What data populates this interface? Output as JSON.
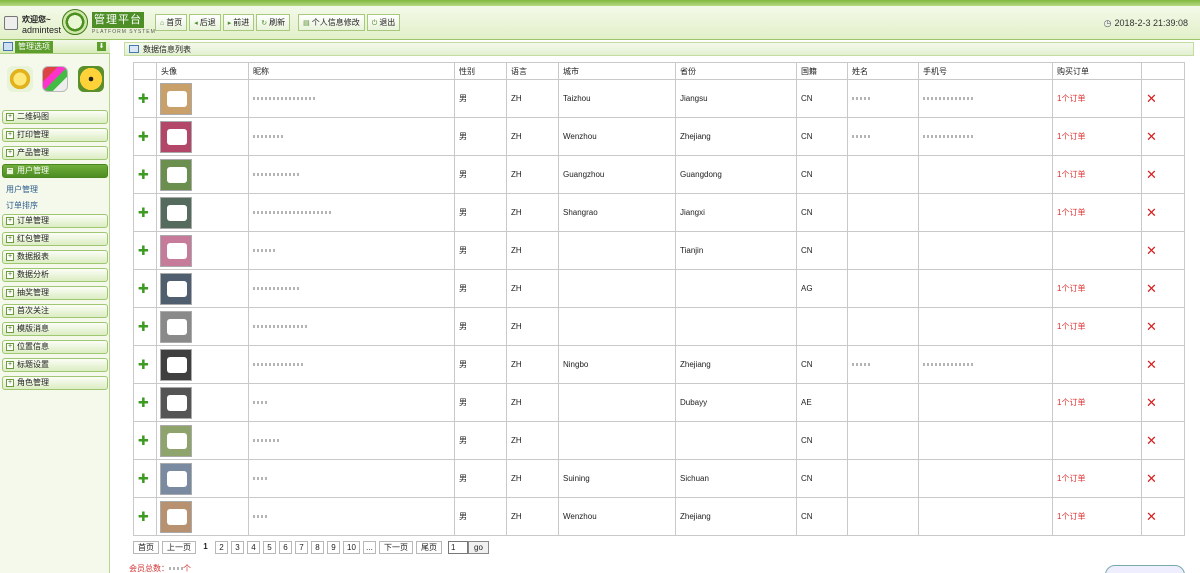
{
  "header": {
    "welcome": "欢迎您~",
    "username": "admintest",
    "logo_title": "管理平台",
    "logo_subtitle": "PLATFORM SYSTEM",
    "nav": [
      {
        "label": "首页",
        "icon": "home-icon"
      },
      {
        "label": "后退",
        "icon": "back-icon"
      },
      {
        "label": "前进",
        "icon": "forward-icon"
      },
      {
        "label": "刷新",
        "icon": "refresh-icon"
      },
      {
        "label": "个人信息修改",
        "icon": "profile-icon"
      },
      {
        "label": "退出",
        "icon": "logout-icon"
      }
    ],
    "datetime": "2018-2-3 21:39:08"
  },
  "sidebar": {
    "title": "管理选项",
    "menu": [
      {
        "label": "二维码图",
        "state": "closed"
      },
      {
        "label": "打印管理",
        "state": "closed"
      },
      {
        "label": "产品管理",
        "state": "closed"
      },
      {
        "label": "用户管理",
        "state": "open",
        "children": [
          "用户管理",
          "订单排序"
        ]
      },
      {
        "label": "订单管理",
        "state": "closed"
      },
      {
        "label": "红包管理",
        "state": "closed"
      },
      {
        "label": "数据报表",
        "state": "closed"
      },
      {
        "label": "数据分析",
        "state": "closed"
      },
      {
        "label": "抽奖管理",
        "state": "closed"
      },
      {
        "label": "首次关注",
        "state": "closed"
      },
      {
        "label": "模版消息",
        "state": "closed"
      },
      {
        "label": "位置信息",
        "state": "closed"
      },
      {
        "label": "标题设置",
        "state": "closed"
      },
      {
        "label": "角色管理",
        "state": "closed"
      }
    ]
  },
  "panel": {
    "title": "数据信息列表"
  },
  "table": {
    "columns": [
      "",
      "头像",
      "昵称",
      "性别",
      "语言",
      "城市",
      "省份",
      "国籍",
      "姓名",
      "手机号",
      "购买订单",
      ""
    ],
    "rows": [
      {
        "sex": "男",
        "lang": "ZH",
        "city": "Taizhou",
        "province": "Jiangsu",
        "country": "CN",
        "has_name": true,
        "has_phone": true,
        "order": "1个订单"
      },
      {
        "sex": "男",
        "lang": "ZH",
        "city": "Wenzhou",
        "province": "Zhejiang",
        "country": "CN",
        "has_name": true,
        "has_phone": true,
        "order": "1个订单"
      },
      {
        "sex": "男",
        "lang": "ZH",
        "city": "Guangzhou",
        "province": "Guangdong",
        "country": "CN",
        "has_name": false,
        "has_phone": false,
        "order": "1个订单"
      },
      {
        "sex": "男",
        "lang": "ZH",
        "city": "Shangrao",
        "province": "Jiangxi",
        "country": "CN",
        "has_name": false,
        "has_phone": false,
        "order": "1个订单"
      },
      {
        "sex": "男",
        "lang": "ZH",
        "city": "",
        "province": "Tianjin",
        "country": "CN",
        "has_name": false,
        "has_phone": false,
        "order": ""
      },
      {
        "sex": "男",
        "lang": "ZH",
        "city": "",
        "province": "",
        "country": "AG",
        "has_name": false,
        "has_phone": false,
        "order": "1个订单"
      },
      {
        "sex": "男",
        "lang": "ZH",
        "city": "",
        "province": "",
        "country": "",
        "has_name": false,
        "has_phone": false,
        "order": "1个订单"
      },
      {
        "sex": "男",
        "lang": "ZH",
        "city": "Ningbo",
        "province": "Zhejiang",
        "country": "CN",
        "has_name": true,
        "has_phone": true,
        "order": ""
      },
      {
        "sex": "男",
        "lang": "ZH",
        "city": "",
        "province": "Dubayy",
        "country": "AE",
        "has_name": false,
        "has_phone": false,
        "order": "1个订单"
      },
      {
        "sex": "男",
        "lang": "ZH",
        "city": "",
        "province": "",
        "country": "CN",
        "has_name": false,
        "has_phone": false,
        "order": ""
      },
      {
        "sex": "男",
        "lang": "ZH",
        "city": "Suining",
        "province": "Sichuan",
        "country": "CN",
        "has_name": false,
        "has_phone": false,
        "order": "1个订单"
      },
      {
        "sex": "男",
        "lang": "ZH",
        "city": "Wenzhou",
        "province": "Zhejiang",
        "country": "CN",
        "has_name": false,
        "has_phone": false,
        "order": "1个订单"
      }
    ]
  },
  "pager": {
    "first": "首页",
    "prev": "上一页",
    "pages": [
      "1",
      "2",
      "3",
      "4",
      "5",
      "6",
      "7",
      "8",
      "9",
      "10",
      "..."
    ],
    "current": "1",
    "next": "下一页",
    "last": "尾页",
    "input_value": "1",
    "go": "go"
  },
  "footer": {
    "total_label": "会员总数：",
    "total_suffix": "个"
  },
  "colors": {
    "accent": "#5d9d2b",
    "order_text": "#e03030",
    "delete": "#d62020"
  }
}
